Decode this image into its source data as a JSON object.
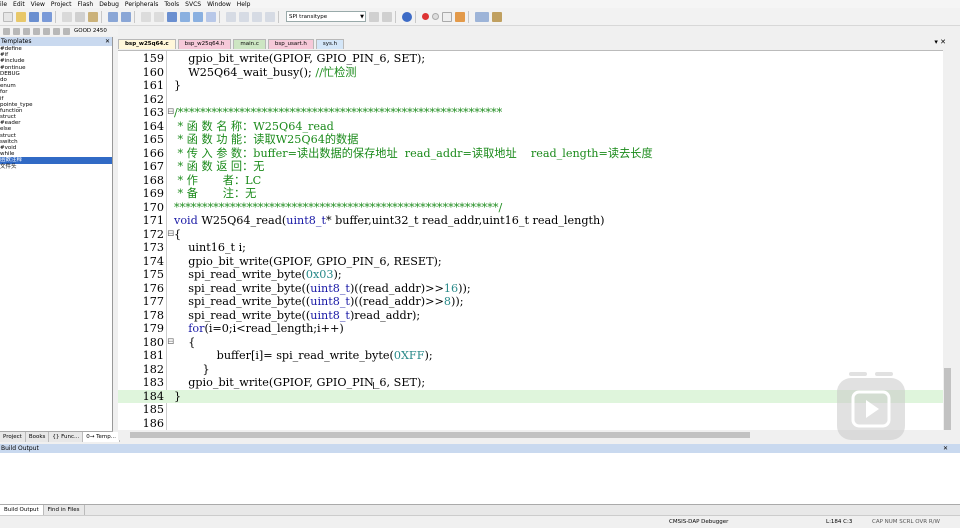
{
  "menu": [
    "File",
    "Edit",
    "View",
    "Project",
    "Flash",
    "Debug",
    "Peripherals",
    "Tools",
    "SVCS",
    "Window",
    "Help"
  ],
  "toolbar": {
    "target_combo": "SPI transitype",
    "goto_combo": "GOOD 2450"
  },
  "left_panel": {
    "title": "Templates",
    "items": [
      "#define",
      "#if",
      "#include",
      "#ontinue",
      "DEBUG",
      "do",
      "enum",
      "for",
      "if",
      "pointe_type",
      "function",
      "struct",
      "#eader",
      "else",
      "struct",
      "switch",
      "#void",
      "while",
      "函数注释",
      "文件头"
    ],
    "selected_index": 18,
    "tabs": [
      "Project",
      "Books",
      "{} Func...",
      "0→ Temp..."
    ],
    "active_tab": 3
  },
  "editor": {
    "tabs": [
      "bsp_w25q64.c",
      "bsp_w25q64.h",
      "main.c",
      "bsp_usart.h",
      "sys.h"
    ],
    "active_tab": 0,
    "highlighted_line": 184,
    "lines": [
      {
        "n": "159",
        "fold": "",
        "code": [
          {
            "t": "    gpio_bit_write(GPIOF, GPIO_PIN_6, SET);",
            "c": ""
          }
        ]
      },
      {
        "n": "160",
        "fold": "",
        "code": [
          {
            "t": "    W25Q64_wait_busy(); ",
            "c": ""
          },
          {
            "t": "//忙检测",
            "c": "cm"
          }
        ]
      },
      {
        "n": "161",
        "fold": "",
        "code": [
          {
            "t": "}",
            "c": ""
          }
        ]
      },
      {
        "n": "162",
        "fold": "",
        "code": [
          {
            "t": "",
            "c": ""
          }
        ]
      },
      {
        "n": "163",
        "fold": "⊟",
        "code": [
          {
            "t": "/**********************************************************",
            "c": "cm"
          }
        ]
      },
      {
        "n": "164",
        "fold": "",
        "code": [
          {
            "t": " * 函 数 名 称：W25Q64_read",
            "c": "cm"
          }
        ]
      },
      {
        "n": "165",
        "fold": "",
        "code": [
          {
            "t": " * 函 数 功 能：读取W25Q64的数据",
            "c": "cm"
          }
        ]
      },
      {
        "n": "166",
        "fold": "",
        "code": [
          {
            "t": " * 传 入 参 数：buffer=读出数据的保存地址  read_addr=读取地址    read_length=读去长度",
            "c": "cm"
          }
        ]
      },
      {
        "n": "167",
        "fold": "",
        "code": [
          {
            "t": " * 函 数 返 回：无",
            "c": "cm"
          }
        ]
      },
      {
        "n": "168",
        "fold": "",
        "code": [
          {
            "t": " * 作       者：LC",
            "c": "cm"
          }
        ]
      },
      {
        "n": "169",
        "fold": "",
        "code": [
          {
            "t": " * 备       注：无",
            "c": "cm"
          }
        ]
      },
      {
        "n": "170",
        "fold": "",
        "code": [
          {
            "t": "**********************************************************/",
            "c": "cm"
          }
        ]
      },
      {
        "n": "171",
        "fold": "",
        "code": [
          {
            "t": "void",
            "c": "kw"
          },
          {
            "t": " W25Q64_read(",
            "c": ""
          },
          {
            "t": "uint8_t",
            "c": "kw"
          },
          {
            "t": "* buffer,uint32_t read_addr,uint16_t read_length)",
            "c": ""
          }
        ]
      },
      {
        "n": "172",
        "fold": "⊟",
        "code": [
          {
            "t": "{",
            "c": ""
          }
        ]
      },
      {
        "n": "173",
        "fold": "",
        "code": [
          {
            "t": "    uint16_t i;",
            "c": ""
          }
        ]
      },
      {
        "n": "174",
        "fold": "",
        "code": [
          {
            "t": "    gpio_bit_write(GPIOF, GPIO_PIN_6, RESET);",
            "c": ""
          }
        ]
      },
      {
        "n": "175",
        "fold": "",
        "code": [
          {
            "t": "    spi_read_write_byte(",
            "c": ""
          },
          {
            "t": "0x03",
            "c": "nm"
          },
          {
            "t": ");",
            "c": ""
          }
        ]
      },
      {
        "n": "176",
        "fold": "",
        "code": [
          {
            "t": "    spi_read_write_byte((",
            "c": ""
          },
          {
            "t": "uint8_t",
            "c": "kw"
          },
          {
            "t": ")((read_addr)>>",
            "c": ""
          },
          {
            "t": "16",
            "c": "nm"
          },
          {
            "t": "));",
            "c": ""
          }
        ]
      },
      {
        "n": "177",
        "fold": "",
        "code": [
          {
            "t": "    spi_read_write_byte((",
            "c": ""
          },
          {
            "t": "uint8_t",
            "c": "kw"
          },
          {
            "t": ")((read_addr)>>",
            "c": ""
          },
          {
            "t": "8",
            "c": "nm"
          },
          {
            "t": "));",
            "c": ""
          }
        ]
      },
      {
        "n": "178",
        "fold": "",
        "code": [
          {
            "t": "    spi_read_write_byte((",
            "c": ""
          },
          {
            "t": "uint8_t",
            "c": "kw"
          },
          {
            "t": ")read_addr);",
            "c": ""
          }
        ]
      },
      {
        "n": "179",
        "fold": "",
        "code": [
          {
            "t": "    ",
            "c": ""
          },
          {
            "t": "for",
            "c": "kw"
          },
          {
            "t": "(i=0;i<read_length;i++)",
            "c": ""
          }
        ]
      },
      {
        "n": "180",
        "fold": "⊟",
        "code": [
          {
            "t": "    {",
            "c": ""
          }
        ]
      },
      {
        "n": "181",
        "fold": "",
        "code": [
          {
            "t": "            buffer[i]= spi_read_write_byte(",
            "c": ""
          },
          {
            "t": "0XFF",
            "c": "nm"
          },
          {
            "t": ");",
            "c": ""
          }
        ]
      },
      {
        "n": "182",
        "fold": "",
        "code": [
          {
            "t": "        }",
            "c": ""
          }
        ]
      },
      {
        "n": "183",
        "fold": "",
        "code": [
          {
            "t": "    gpio_bit_write(GPIOF, GPIO_PIN_6, SET);",
            "c": ""
          }
        ]
      },
      {
        "n": "184",
        "fold": "",
        "code": [
          {
            "t": "}",
            "c": ""
          }
        ]
      },
      {
        "n": "185",
        "fold": "",
        "code": [
          {
            "t": "",
            "c": ""
          }
        ]
      },
      {
        "n": "186",
        "fold": "",
        "code": [
          {
            "t": "",
            "c": ""
          }
        ]
      }
    ]
  },
  "build_output": {
    "title": "Build Output",
    "tabs": [
      "Build Output",
      "Find in Files"
    ]
  },
  "status": {
    "debugger": "CMSIS-DAP Debugger",
    "position": "L:184 C:3",
    "indicators": "CAP  NUM  SCRL  OVR  R/W"
  }
}
